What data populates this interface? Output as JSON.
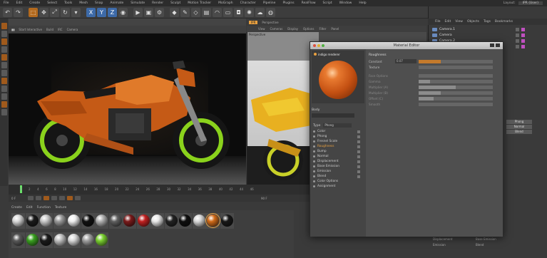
{
  "menubar": {
    "items": [
      "File",
      "Edit",
      "Create",
      "Select",
      "Tools",
      "Mesh",
      "Snap",
      "Animate",
      "Simulate",
      "Render",
      "Sculpt",
      "Motion Tracker",
      "MoGraph",
      "Character",
      "Pipeline",
      "Plugins",
      "RealFlow",
      "Script",
      "Window",
      "Help"
    ],
    "layout_label": "Layout:",
    "layout_value": "IPR (User)"
  },
  "viewport": {
    "tabs": [
      "IPR",
      "Perspective"
    ],
    "header_items": [
      "Start Interactive",
      "Build",
      "IRC",
      "Camera"
    ],
    "bucket_label": "Bucket",
    "title": "Perspective"
  },
  "ipr_view": {
    "tabs": [
      "View",
      "Cameras",
      "Display",
      "Options",
      "Filter",
      "Panel"
    ],
    "title_tab": "Perspective",
    "view_label": "Perspective"
  },
  "object_manager": {
    "menu": [
      "File",
      "Edit",
      "View",
      "Objects",
      "Tags",
      "Bookmarks"
    ],
    "objects": [
      "Camera.1",
      "Camera",
      "Camera.2",
      "Camera.3"
    ]
  },
  "attr_buttons": [
    "Phong",
    "Normal",
    "Blend"
  ],
  "material_editor": {
    "title": "Material Editor",
    "logo": "indigo renderer",
    "material_name_label": "Body",
    "type_label": "Type",
    "type_value": "Phong",
    "channels": [
      {
        "label": "Color",
        "active": false
      },
      {
        "label": "Phong",
        "active": false
      },
      {
        "label": "Fresnel Scale",
        "active": false
      },
      {
        "label": "Roughness",
        "active": true
      },
      {
        "label": "Bump",
        "active": false
      },
      {
        "label": "Normal",
        "active": false
      },
      {
        "label": "Displacement",
        "active": false
      },
      {
        "label": "Base Emission",
        "active": false
      },
      {
        "label": "Emission",
        "active": false
      },
      {
        "label": "Blend",
        "active": false
      },
      {
        "label": "Color Options",
        "active": false
      },
      {
        "label": "Assignment",
        "active": false
      }
    ],
    "section_title": "Roughness",
    "params": [
      {
        "label": "Constant",
        "value": "0.07",
        "fill": 0.3,
        "orange": true
      },
      {
        "label": "Texture",
        "value": "",
        "fill": 0,
        "orange": false
      },
      {
        "label": "Face Options",
        "value": "",
        "fill": 0,
        "orange": false
      },
      {
        "label": "Gamma",
        "value": "",
        "fill": 0.15,
        "orange": false
      },
      {
        "label": "Multiplier (A)",
        "value": "",
        "fill": 0.5,
        "orange": false
      },
      {
        "label": "Multiplier (B)",
        "value": "",
        "fill": 0.3,
        "orange": false
      },
      {
        "label": "Offset (C)",
        "value": "",
        "fill": 0.2,
        "orange": false
      },
      {
        "label": "Smooth",
        "value": "",
        "fill": 0,
        "orange": false
      }
    ]
  },
  "timeline": {
    "ticks": [
      "0",
      "2",
      "4",
      "6",
      "8",
      "10",
      "12",
      "14",
      "16",
      "18",
      "20",
      "22",
      "24",
      "26",
      "28",
      "30",
      "32",
      "34",
      "36",
      "38",
      "40",
      "42",
      "44",
      "46"
    ],
    "start_value": "0 F",
    "end_value": "90 F"
  },
  "material_manager": {
    "menu": [
      "Create",
      "Edit",
      "Function",
      "Texture"
    ],
    "swatches": [
      {
        "color": "#d8d8d8"
      },
      {
        "color": "#1a1a1a"
      },
      {
        "color": "#c8c8c8"
      },
      {
        "color": "#9a9a9a"
      },
      {
        "color": "#efefef"
      },
      {
        "color": "#101010"
      },
      {
        "color": "#b0b0b0"
      },
      {
        "color": "#606060"
      },
      {
        "color": "#7a1a1a"
      },
      {
        "color": "#c02020"
      },
      {
        "color": "#e8e8e8"
      },
      {
        "color": "#222222"
      },
      {
        "color": "#0e0e0e"
      },
      {
        "color": "#d8d8d8"
      },
      {
        "color": "#d06a18"
      },
      {
        "color": "#181818"
      },
      {
        "color": "#5a5a5a"
      },
      {
        "color": "#3aa020"
      },
      {
        "color": "#1a1a1a"
      },
      {
        "color": "#c0c0c0"
      },
      {
        "color": "#d8d8d8"
      },
      {
        "color": "#a0a0a0"
      },
      {
        "color": "#7ad030"
      }
    ],
    "selected_index": 14
  },
  "bottom_right": {
    "items": [
      "Displacement",
      "Base Emission",
      "Emission",
      "Blend"
    ]
  }
}
